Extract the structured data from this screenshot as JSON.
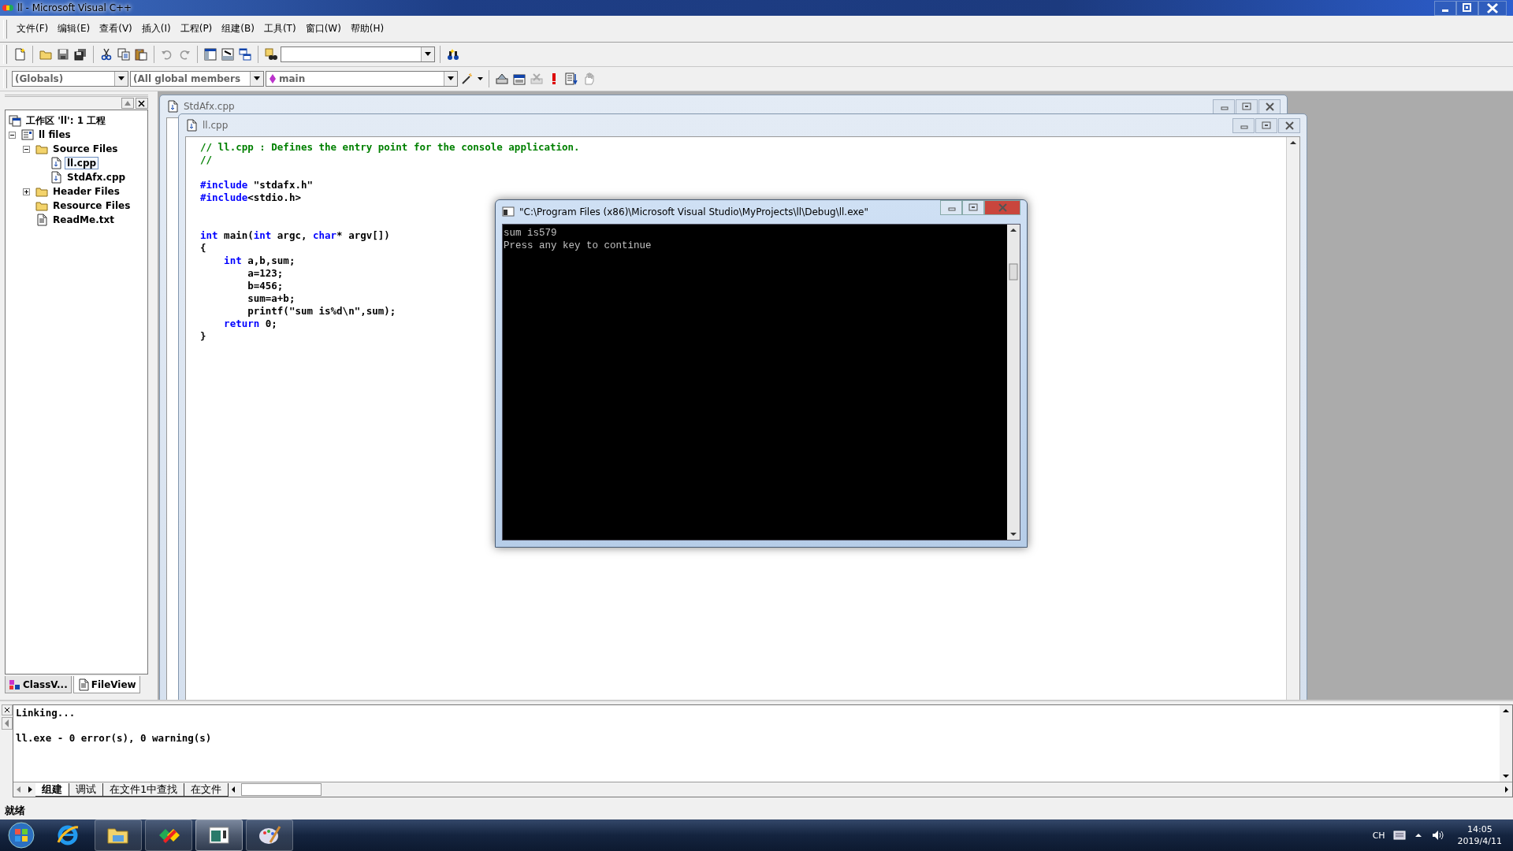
{
  "window": {
    "title": "ll - Microsoft Visual C++"
  },
  "menu": [
    "文件(F)",
    "编辑(E)",
    "查看(V)",
    "插入(I)",
    "工程(P)",
    "组建(B)",
    "工具(T)",
    "窗口(W)",
    "帮助(H)"
  ],
  "class_bar": {
    "scope": "(Globals)",
    "members": "(All global members",
    "function": "main"
  },
  "workspace": {
    "tree": [
      {
        "label": "工作区 'll': 1 工程",
        "kind": "workspace",
        "selected": false,
        "children": [
          {
            "label": "ll files",
            "kind": "project",
            "selected": false,
            "expanded": true,
            "children": [
              {
                "label": "Source Files",
                "kind": "folder",
                "selected": false,
                "expanded": true,
                "children": [
                  {
                    "label": "ll.cpp",
                    "kind": "source",
                    "selected": true
                  },
                  {
                    "label": "StdAfx.cpp",
                    "kind": "source",
                    "selected": false
                  }
                ]
              },
              {
                "label": "Header Files",
                "kind": "folder",
                "selected": false,
                "expanded": false
              },
              {
                "label": "Resource Files",
                "kind": "folder",
                "selected": false
              },
              {
                "label": "ReadMe.txt",
                "kind": "text",
                "selected": false
              }
            ]
          }
        ]
      }
    ],
    "tabs": [
      {
        "label": "ClassV...",
        "kind": "class",
        "selected": false
      },
      {
        "label": "FileView",
        "kind": "file",
        "selected": true
      }
    ]
  },
  "documents": [
    {
      "title": "StdAfx.cpp"
    },
    {
      "title": "ll.cpp",
      "code": [
        {
          "kind": "comment",
          "text": "// ll.cpp : Defines the entry point for the console application.\n//\n\n"
        },
        {
          "kind": "keyword",
          "text": "#include"
        },
        {
          "kind": "plain",
          "text": " \"stdafx.h\"\n"
        },
        {
          "kind": "keyword",
          "text": "#include"
        },
        {
          "kind": "plain",
          "text": "<stdio.h>\n\n\n"
        },
        {
          "kind": "keyword",
          "text": "int"
        },
        {
          "kind": "plain",
          "text": " main("
        },
        {
          "kind": "keyword",
          "text": "int"
        },
        {
          "kind": "plain",
          "text": " argc, "
        },
        {
          "kind": "keyword",
          "text": "char"
        },
        {
          "kind": "plain",
          "text": "* argv[])\n{\n    "
        },
        {
          "kind": "keyword",
          "text": "int"
        },
        {
          "kind": "plain",
          "text": " a,b,sum;\n        a=123;\n        b=456;\n        sum=a+b;\n        printf(\"sum is%d\\n\",sum);\n    "
        },
        {
          "kind": "keyword",
          "text": "return"
        },
        {
          "kind": "plain",
          "text": " 0;\n}"
        }
      ]
    }
  ],
  "console": {
    "title": "\"C:\\Program Files (x86)\\Microsoft Visual Studio\\MyProjects\\ll\\Debug\\ll.exe\"",
    "lines": [
      "sum is579",
      "Press any key to continue"
    ]
  },
  "output": {
    "text": "Linking...\n\nll.exe - 0 error(s), 0 warning(s)",
    "tabs": [
      {
        "label": "组建",
        "selected": true
      },
      {
        "label": "调试",
        "selected": false
      },
      {
        "label": "在文件1中查找",
        "selected": false
      },
      {
        "label": "在文件",
        "selected": false
      }
    ]
  },
  "status_bar": {
    "text": "就绪"
  },
  "taskbar": {
    "language": "CH",
    "time": "14:05",
    "date": "2019/4/11"
  }
}
